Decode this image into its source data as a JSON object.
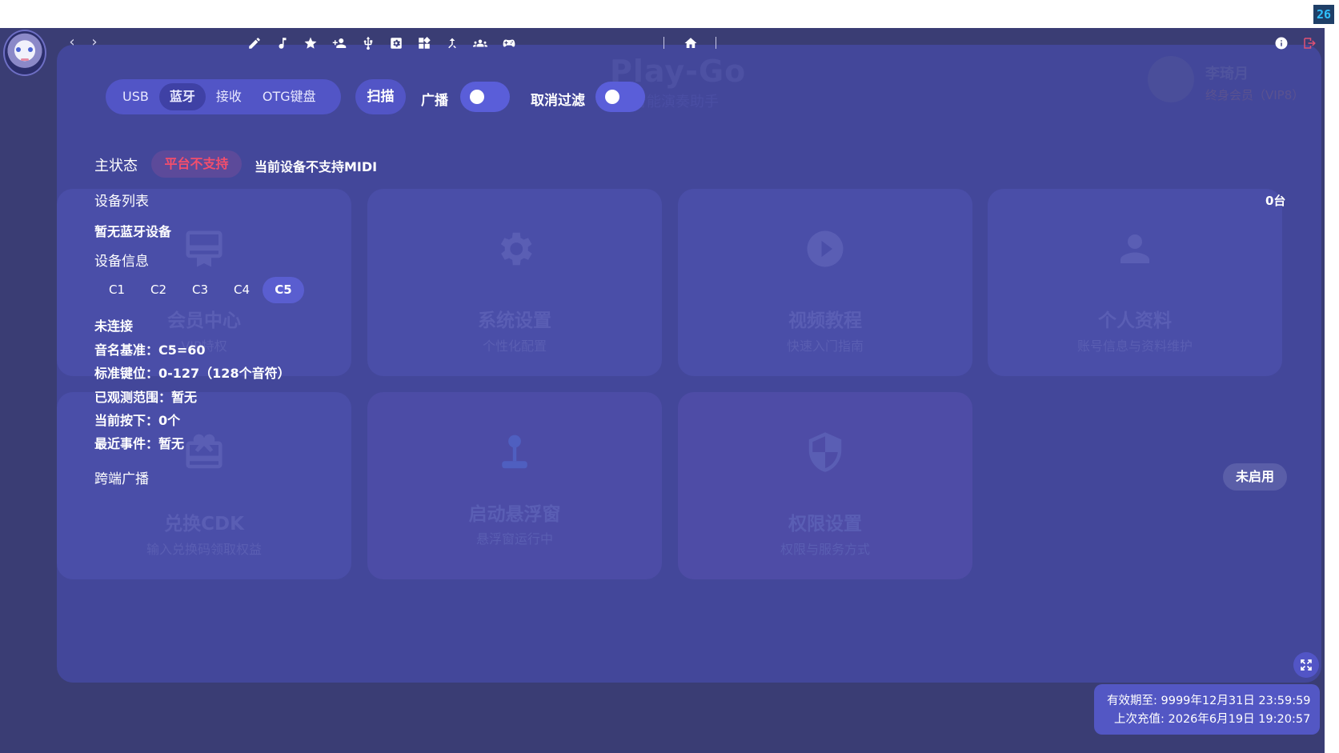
{
  "corner_badge": "26",
  "background": {
    "title": "Play-Go",
    "subtitle": "智能演奏助手",
    "user_name": "李琦月",
    "user_role": "终身会员（VIP8）",
    "tiles": [
      {
        "title": "会员中心",
        "subtitle": "VIP特权",
        "icon": "card-membership-icon"
      },
      {
        "title": "系统设置",
        "subtitle": "个性化配置",
        "icon": "gear-icon"
      },
      {
        "title": "视频教程",
        "subtitle": "快速入门指南",
        "icon": "play-circle-icon"
      },
      {
        "title": "个人资料",
        "subtitle": "账号信息与资料维护",
        "icon": "person-icon"
      },
      {
        "title": "兑换CDK",
        "subtitle": "输入兑换码领取权益",
        "icon": "card-redeem-icon"
      },
      {
        "title": "启动悬浮窗",
        "subtitle": "悬浮窗运行中",
        "icon": "joystick-icon"
      },
      {
        "title": "权限设置",
        "subtitle": "权限与服务方式",
        "icon": "shield-icon"
      }
    ]
  },
  "toolbar": {
    "icons": [
      "back-icon",
      "forward-icon",
      "pencil-icon",
      "music-note-icon",
      "star-icon",
      "person-add-icon",
      "usb-icon",
      "settings-box-icon",
      "widgets-icon",
      "merge-icon",
      "group-icon",
      "gamepad-icon",
      "home-icon",
      "info-icon",
      "exit-icon"
    ]
  },
  "connection": {
    "tabs": [
      "USB",
      "蓝牙",
      "接收",
      "OTG键盘"
    ],
    "active_tab": "蓝牙",
    "scan_label": "扫描",
    "broadcast_label": "广播",
    "broadcast_on": false,
    "cancel_filter_label": "取消过滤",
    "cancel_filter_on": false
  },
  "main_status": {
    "label": "主状态",
    "badge": "平台不支持",
    "message": "当前设备不支持MIDI"
  },
  "device_list": {
    "label": "设备列表",
    "count": "0台",
    "empty_text": "暂无蓝牙设备"
  },
  "device_info": {
    "label": "设备信息",
    "keys": [
      "C1",
      "C2",
      "C3",
      "C4",
      "C5"
    ],
    "active_key": "C5",
    "connection_state": "未连接",
    "lines": [
      "音名基准：C5=60",
      "标准键位：0-127（128个音符）",
      "已观测范围：暂无",
      "当前按下：0个",
      "最近事件：暂无"
    ]
  },
  "cross_broadcast": {
    "label": "跨端广播",
    "button": "未启用"
  },
  "footer": {
    "expiry": "有效期至: 9999年12月31日 23:59:59",
    "last_recharge": "上次充值: 2026年6月19日 19:20:57"
  },
  "colors": {
    "app_bg": "#3a3d74",
    "panel_bg": "#43479a",
    "accent": "#5255c6",
    "error": "#f44e6c"
  }
}
